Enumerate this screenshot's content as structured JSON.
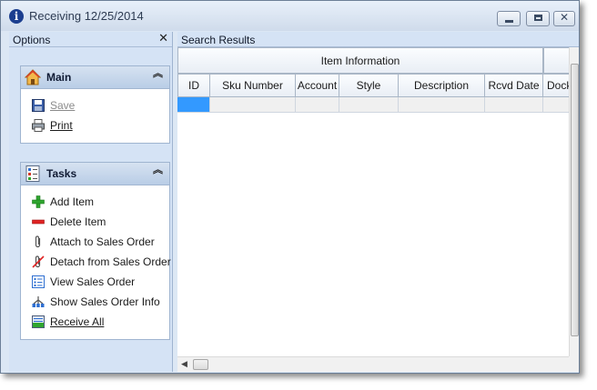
{
  "window": {
    "title": "Receiving 12/25/2014",
    "app_icon": "info-icon",
    "close_glyph": "✕"
  },
  "options_pane": {
    "title": "Options",
    "close_glyph": "✕",
    "main_group": {
      "title": "Main",
      "collapse_glyph": "︽",
      "items": [
        {
          "label": "Save",
          "icon": "save-icon",
          "enabled": false
        },
        {
          "label": "Print",
          "icon": "printer-icon",
          "enabled": true
        }
      ]
    },
    "tasks_group": {
      "title": "Tasks",
      "collapse_glyph": "︽",
      "items": [
        {
          "label": "Add Item",
          "icon": "plus-icon"
        },
        {
          "label": "Delete Item",
          "icon": "minus-icon"
        },
        {
          "label": "Attach to Sales Order",
          "icon": "paperclip-icon"
        },
        {
          "label": "Detach from Sales Order",
          "icon": "paperclip-remove-icon"
        },
        {
          "label": "View Sales Order",
          "icon": "list-icon"
        },
        {
          "label": "Show Sales Order Info",
          "icon": "tree-icon"
        },
        {
          "label": "Receive All",
          "icon": "receive-all-icon"
        }
      ]
    }
  },
  "results_pane": {
    "title": "Search Results",
    "band_header": "Item Information",
    "columns": [
      "ID",
      "Sku Number",
      "Account",
      "Style",
      "Description",
      "Rcvd Date",
      "Dock"
    ]
  },
  "colors": {
    "accent_selection": "#3399ff",
    "plus_green": "#2fa52f",
    "minus_red": "#e02424"
  }
}
